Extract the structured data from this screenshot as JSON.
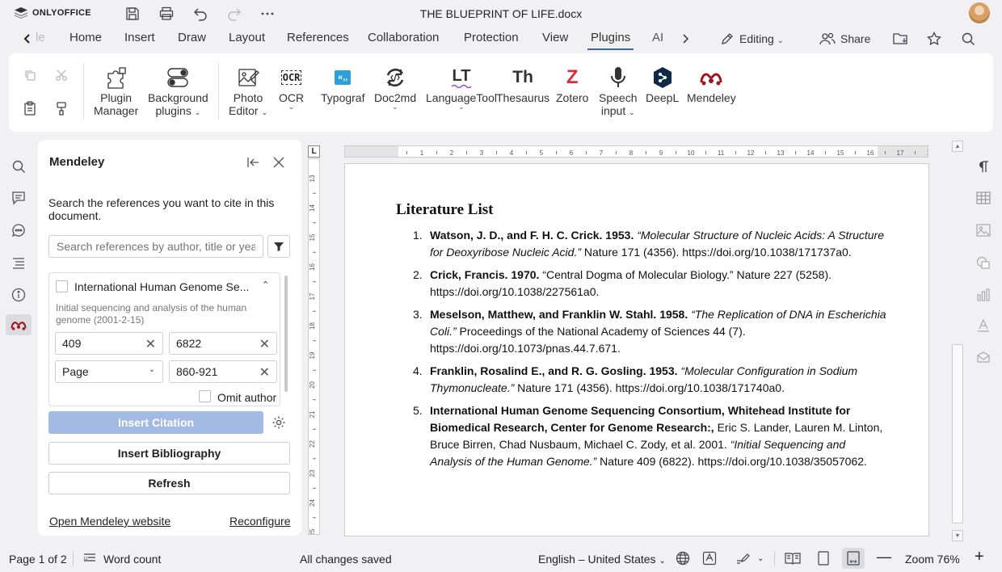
{
  "app": {
    "brand": "ONLYOFFICE",
    "doc_title": "THE BLUEPRINT OF LIFE.docx"
  },
  "tabs": {
    "partial_left": "le",
    "items": [
      "Home",
      "Insert",
      "Draw",
      "Layout",
      "References",
      "Collaboration",
      "Protection",
      "View",
      "Plugins",
      "AI"
    ],
    "active": "Plugins",
    "editing_label": "Editing",
    "share_label": "Share"
  },
  "plugins": [
    {
      "label": "Plugin Manager",
      "line1": "Plugin",
      "line2": "Manager"
    },
    {
      "label": "Background plugins",
      "line1": "Background",
      "line2": "plugins"
    },
    {
      "label": "Photo Editor",
      "line1": "Photo",
      "line2": "Editor"
    },
    {
      "label": "OCR",
      "line1": "OCR",
      "line2": ""
    },
    {
      "label": "Typograf",
      "line1": "Typograf",
      "line2": ""
    },
    {
      "label": "Doc2md",
      "line1": "Doc2md",
      "line2": ""
    },
    {
      "label": "LanguageTool",
      "line1": "LanguageTool",
      "line2": ""
    },
    {
      "label": "Thesaurus",
      "line1": "Thesaurus",
      "line2": ""
    },
    {
      "label": "Zotero",
      "line1": "Zotero",
      "line2": ""
    },
    {
      "label": "Speech input",
      "line1": "Speech",
      "line2": "input"
    },
    {
      "label": "DeepL",
      "line1": "DeepL",
      "line2": ""
    },
    {
      "label": "Mendeley",
      "line1": "Mendeley",
      "line2": ""
    }
  ],
  "plugin_icon_text": {
    "ocr": "OCR",
    "typograf": "«,,",
    "languagetool": "LT",
    "thesaurus": "Th",
    "zotero": "Z"
  },
  "mendeley": {
    "title": "Mendeley",
    "description": "Search the references you want to cite in this document.",
    "search_placeholder": "Search references by author, title or yea",
    "card": {
      "title": "International Human Genome Se...",
      "subtitle": "Initial sequencing and analysis of the human genome (2001-2-15)",
      "field1": "409",
      "field2": "6822",
      "locator_type": "Page",
      "locator_value": "860-921",
      "omit_author": "Omit author"
    },
    "insert_citation": "Insert Citation",
    "insert_bibliography": "Insert Bibliography",
    "refresh": "Refresh",
    "open_website": "Open Mendeley website",
    "reconfigure": "Reconfigure"
  },
  "ruler": {
    "corner": "L",
    "h_ticks": [
      "1",
      "2",
      "3",
      "4",
      "5",
      "6",
      "7",
      "8",
      "9",
      "10",
      "11",
      "12",
      "13",
      "14",
      "15",
      "16",
      "17",
      "18",
      "19"
    ],
    "v_ticks": [
      "13",
      "14",
      "15",
      "16",
      "17",
      "18",
      "19",
      "20",
      "21",
      "22",
      "23",
      "24",
      "25"
    ]
  },
  "document": {
    "heading": "Literature List",
    "references": [
      {
        "num": "1.",
        "bold": "Watson, J. D., and F. H. C. Crick. 1953.",
        "italic": "“Molecular Structure of Nucleic Acids: A Structure for Deoxyribose Nucleic Acid.”",
        "rest": " Nature 171 (4356). https://doi.org/10.1038/171737a0."
      },
      {
        "num": "2.",
        "bold": "Crick, Francis. 1970.",
        "italic": "",
        "rest": " “Central Dogma of Molecular Biology.” Nature 227 (5258). https://doi.org/10.1038/227561a0."
      },
      {
        "num": "3.",
        "bold": "Meselson, Matthew, and Franklin W. Stahl. 1958.",
        "italic": " “The Replication of DNA in Escherichia Coli.”",
        "rest": " Proceedings of the National Academy of Sciences 44 (7). https://doi.org/10.1073/pnas.44.7.671."
      },
      {
        "num": "4.",
        "bold": "Franklin, Rosalind E., and R. G. Gosling. 1953.",
        "italic": " “Molecular Configuration in Sodium Thymonucleate.”",
        "rest": " Nature 171 (4356). https://doi.org/10.1038/171740a0."
      },
      {
        "num": "5.",
        "bold": "International Human Genome Sequencing Consortium, Whitehead Institute for Biomedical Research, Center for Genome Research:,",
        "italic": "",
        "rest": " Eric S. Lander, Lauren M. Linton, Bruce Birren, Chad Nusbaum, Michael C. Zody, et al. 2001. ",
        "italic2": "“Initial Sequencing and Analysis of the Human Genome.”",
        "rest2": " Nature 409 (6822). https://doi.org/10.1038/35057062."
      }
    ]
  },
  "status": {
    "page": "Page 1 of 2",
    "word_count": "Word count",
    "saved": "All changes saved",
    "language": "English – United States",
    "zoom": "Zoom 76%"
  },
  "colors": {
    "accent": "#446995",
    "primary_button": "#a3bbe4",
    "zotero": "#db2c3a",
    "mendeley": "#9d1620",
    "deepl": "#0f2b46",
    "typograf": "#2b9fd8",
    "languagetool_wave": "#8a4fd8"
  }
}
